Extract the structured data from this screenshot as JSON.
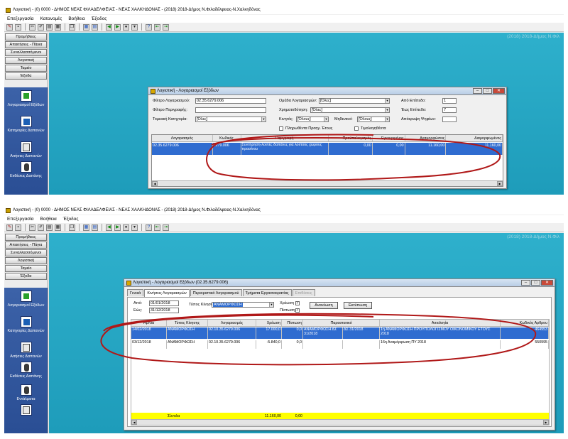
{
  "window": {
    "title": "Λογιστική - (0) 0000 - ΔΗΜΟΣ ΝΕΑΣ ΦΙΛΑΔΕΛΦΕΙΑΣ - ΝΕΑΣ ΧΑΛΚΗΔΟΝΑΣ - (2018) 2018-Δήμος Ν.Φιλαδέλφειας-Ν.Χαλκηδόνας",
    "workspace_caption": "(2018)   2018-Δήμος Ν.Φιλ"
  },
  "menu": [
    "Επεξεργασία",
    "Κατανομές",
    "Βοήθεια",
    "Έξοδος"
  ],
  "left_buttons": [
    "Προμήθειες",
    "Απαιτήσεις - Πάγια",
    "Συναλλασσόμενοι",
    "Λογιστική",
    "Ταμείο",
    "Έξοδα"
  ],
  "nav_items": [
    "Λογαριασμοί Εξόδων",
    "Κατηγορίες Δαπανών",
    "Αιτήσεις Δαπανών",
    "Εκθέσεις Δαπάνης",
    "Εντάλματα"
  ],
  "dialog1": {
    "title": "Λογιστική - Λογαριασμοί Εξόδων",
    "labels": {
      "account_filter": "Φίλτρο Λογαριασμού:",
      "description_filter": "Φίλτρο Περιγραφής:",
      "sector_category": "Τομεακή Κατηγορία:",
      "account_group": "Ομάδα Λογαριασμών:",
      "funder": "Χρηματοδότηση:",
      "movable": "Κινητός:",
      "zero": "Μηδενικοί:",
      "from_level": "Από Επίπεδο:",
      "to_level": "Έως Επίπεδο:",
      "hide_fields": "Απόκρυψη Ψηφίων:",
      "expired": "Πληρωθέντα Προηγ. Έτους",
      "confirmed": "Τιμολογηθέντα"
    },
    "values": {
      "account_filter": "02.35.6279.006",
      "description_filter": "",
      "sector_category": "[Όλες]",
      "account_group": "[Όλες]",
      "funder": "[Όλες]",
      "movable": "[Όλους]",
      "zero": "[Όλους]",
      "from_level": "1",
      "to_level": "7",
      "hide_fields": ""
    },
    "columns": [
      "Λογαριασμός",
      "Κωδικός",
      "Περιγραφή",
      "Προϋπολογισμός",
      "Εγκεκριμένος",
      "Αναμορφώσεις",
      "Διαμορφωμένος"
    ],
    "row": [
      "02.35.6279.006",
      "6279.006",
      "Συντήρηση-λοιπές δαπάνες για λοιπούς χώρους πρασίνου",
      "0,00",
      "0,00",
      "11.160,00",
      "11.160,00"
    ]
  },
  "dialog2": {
    "title": "Λογιστική - Λογαριασμοί Εξόδων (02.35.6279.006)",
    "tabs": [
      "Γενικά",
      "Κινήσεις Λογαριασμών",
      "Περιοριστικό Λογαριασμού",
      "Τμήματα Εργασιοκρατίας",
      "Επιθέσεις"
    ],
    "labels": {
      "from": "Από:",
      "to": "Εώς:",
      "movement_type": "Τύπος Κίνησης:",
      "debit": "Χρέωση",
      "credit": "Πίστωση"
    },
    "values": {
      "from_date": "01/01/2018",
      "to_date": "31/12/2018",
      "movement_type": "ΑΝΑΜΟΡΦΩΣΗ"
    },
    "buttons": {
      "refresh": "Ανανέωση",
      "print": "Εκτύπωση"
    },
    "columns": [
      "Ημ/νία",
      "Τύπος Κίνησης",
      "Λογαριασμός",
      "Χρέωση",
      "Πίστωση",
      "Παραστατικό",
      "Αιτιολογία",
      "Κωδικός Αρθρου"
    ],
    "rows": [
      [
        "14/02/2018",
        "ΑΝΑΜΟΡΦΩΣΗ",
        "02.10.35.6279.006",
        "17.000,0",
        "0,0",
        "ΑΝΑΜΟΡΦΩΣΗ ΔΣ 31/2018",
        "ΔΣ 31/2018",
        "1η ΑΝΑΜΟΡΦΩΣΗ ΠΡΟΫΠΟΛΟΓΙΣΜΟΥ ΟΙΚΟΝΟΜΙΚΟΥ ΕΤΟΥΣ 2018",
        "464953"
      ],
      [
        "03/12/2018",
        "ΑΝΑΜΟΡΦΩΣΗ",
        "02.10.35.6279.006",
        "-5.840,0",
        "0,0",
        "",
        "",
        "16η Αναμόρφωση ΠΥ 2018",
        "550995"
      ]
    ],
    "totals": {
      "label": "Σύνολα",
      "debit": "11.160,00",
      "credit": "0,00"
    }
  },
  "colors": {
    "selection": "#2f6cd0",
    "workspace": "#2eb0cc",
    "nav": "#3c62a8",
    "totals": "#ffff00",
    "annotation": "#b01818"
  }
}
